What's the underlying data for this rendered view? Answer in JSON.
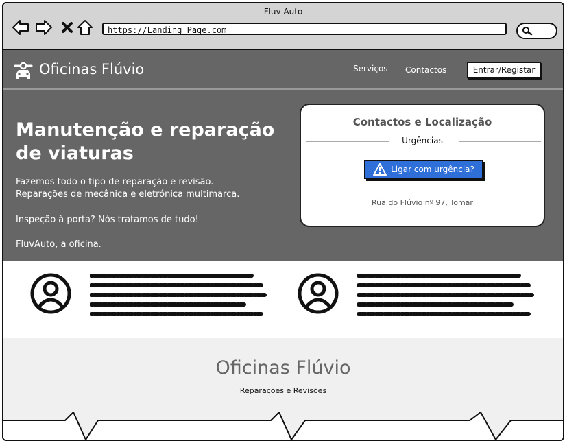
{
  "window": {
    "title": "Fluv Auto"
  },
  "browser": {
    "url": "https://Landing_Page.com"
  },
  "site": {
    "brand": "Oficinas Flúvio",
    "nav": {
      "services": "Serviços",
      "contacts": "Contactos"
    },
    "login_label": "Entrar/Registar"
  },
  "hero": {
    "headline": "Manutenção e reparação de viaturas",
    "lines": [
      "Fazemos todo o tipo de reparação e revisão.",
      "Reparações de mecânica e eletrónica multimarca.",
      "Inspeção à porta? Nós tratamos de tudo!",
      "FluvAuto, a oficina."
    ]
  },
  "contact_card": {
    "title": "Contactos e Localização",
    "subtitle": "Urgências",
    "urgent_button": "Ligar com urgência?",
    "address": "Rua do Flúvio nº 97, Tomar"
  },
  "footer": {
    "title": "Oficinas Flúvio",
    "subtitle": "Reparações e Revisões"
  },
  "colors": {
    "hero_bg": "#666666",
    "accent_button": "#2f6fd8",
    "footer_bg": "#f0f0f0"
  },
  "icons": [
    "back-arrow-icon",
    "forward-arrow-icon",
    "close-icon",
    "home-icon",
    "search-icon",
    "mechanic-logo-icon",
    "warning-icon",
    "user-avatar-icon"
  ]
}
